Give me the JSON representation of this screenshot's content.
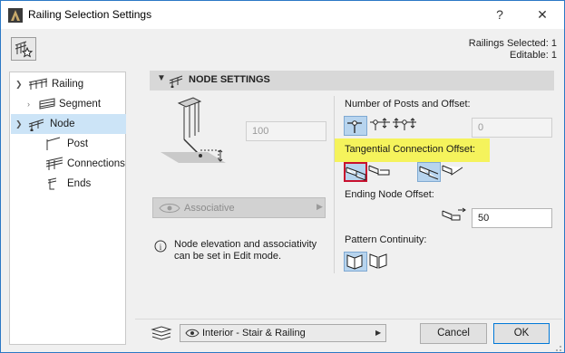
{
  "window": {
    "title": "Railing Selection Settings"
  },
  "titlebar": {
    "help_glyph": "?",
    "close_glyph": "✕"
  },
  "header": {
    "railings_selected": "Railings Selected: 1",
    "editable": "Editable: 1"
  },
  "tree": {
    "items": [
      {
        "label": "Railing",
        "icon": "railing-icon",
        "expanded": true
      },
      {
        "label": "Segment",
        "icon": "segment-icon"
      },
      {
        "label": "Node",
        "icon": "node-icon",
        "selected": true
      },
      {
        "label": "Post",
        "icon": "post-icon"
      },
      {
        "label": "Connections",
        "icon": "connections-icon"
      },
      {
        "label": "Ends",
        "icon": "ends-icon"
      }
    ]
  },
  "node_settings": {
    "section_title": "NODE SETTINGS",
    "elevation_value": "100",
    "associative_label": "Associative",
    "info_text_line1": "Node elevation and associativity",
    "info_text_line2": "can be set in Edit mode.",
    "posts_label": "Number of Posts and Offset:",
    "posts_offset_value": "0",
    "tangential_label": "Tangential Connection Offset:",
    "ending_label": "Ending Node Offset:",
    "ending_value": "50",
    "pattern_label": "Pattern Continuity:"
  },
  "footer": {
    "layer_combo": "Interior - Stair & Railing",
    "cancel_label": "Cancel",
    "ok_label": "OK"
  },
  "colors": {
    "selection": "#cce4f7",
    "highlight": "#f5f35c",
    "pressed": "#b7d4ee",
    "red_frame": "#c8102e"
  }
}
